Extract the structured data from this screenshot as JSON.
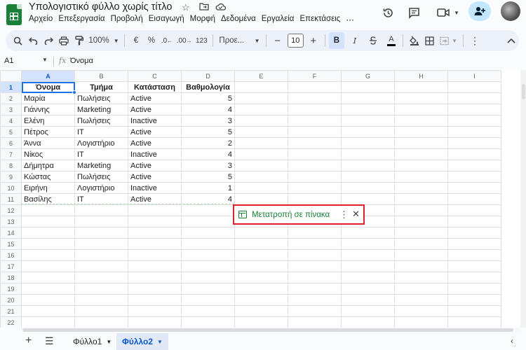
{
  "app": {
    "title": "Υπολογιστικό φύλλο χωρίς τίτλο",
    "menu": [
      "Αρχείο",
      "Επεξεργασία",
      "Προβολή",
      "Εισαγωγή",
      "Μορφή",
      "Δεδομένα",
      "Εργαλεία",
      "Επεκτάσεις"
    ]
  },
  "toolbar": {
    "zoom": "100%",
    "currency": "€",
    "percent": "%",
    "decrease_decimals": ".0",
    "increase_decimals": ".00",
    "number_format": "123",
    "font": "Προε...",
    "font_size": "10",
    "bold": "B",
    "italic": "I",
    "text_color": "A"
  },
  "formula_bar": {
    "cell_ref": "A1",
    "fx": "fx",
    "content": "Όνομα"
  },
  "grid": {
    "columns": [
      "A",
      "B",
      "C",
      "D",
      "E",
      "F",
      "G",
      "H",
      "I"
    ],
    "row_numbers": [
      "1",
      "2",
      "3",
      "4",
      "5",
      "6",
      "7",
      "8",
      "9",
      "10",
      "11",
      "12",
      "13",
      "14",
      "15",
      "16",
      "17",
      "18",
      "19",
      "20",
      "21",
      "22"
    ],
    "headers": [
      "Όνομα",
      "Τμήμα",
      "Κατάσταση",
      "Βαθμολογία"
    ],
    "rows": [
      [
        "Μαρία",
        "Πωλήσεις",
        "Active",
        "5"
      ],
      [
        "Γιάννης",
        "Marketing",
        "Active",
        "4"
      ],
      [
        "Ελένη",
        "Πωλήσεις",
        "Inactive",
        "3"
      ],
      [
        "Πέτρος",
        "IT",
        "Active",
        "5"
      ],
      [
        "Άννα",
        "Λογιστήριο",
        "Active",
        "2"
      ],
      [
        "Νίκος",
        "IT",
        "Inactive",
        "4"
      ],
      [
        "Δήμητρα",
        "Marketing",
        "Active",
        "3"
      ],
      [
        "Κώστας",
        "Πωλήσεις",
        "Active",
        "5"
      ],
      [
        "Ειρήνη",
        "Λογιστήριο",
        "Inactive",
        "1"
      ],
      [
        "Βασίλης",
        "IT",
        "Active",
        "4"
      ]
    ]
  },
  "convert_chip": {
    "label": "Μετατροπή σε πίνακα"
  },
  "sheets": {
    "tabs": [
      "Φύλλο1",
      "Φύλλο2"
    ],
    "active": "Φύλλο2"
  }
}
